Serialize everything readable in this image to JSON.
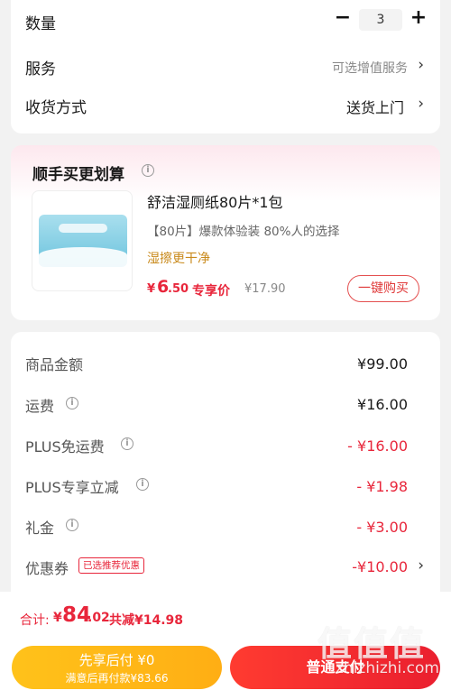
{
  "order": {
    "quantity_label": "数量",
    "quantity_value": "3",
    "minus_glyph": "−",
    "plus_glyph": "+",
    "service_label": "服务",
    "service_value": "可选增值服务",
    "delivery_label": "收货方式",
    "delivery_value": "送货上门",
    "chevron_glyph": "›"
  },
  "bundle": {
    "title": "顺手买更划算",
    "info_glyph": "i",
    "product": {
      "name": "舒洁湿厕纸80片*1包",
      "description": "【80片】爆款体验装 80%人的选择",
      "tag": "湿擦更干净",
      "price_symbol": "¥",
      "price_integer": "6",
      "price_decimal": ".50",
      "price_label": "专享价",
      "original_price": "¥17.90",
      "buy_button": "一键购买"
    }
  },
  "summary": {
    "rows": [
      {
        "label": "商品金额",
        "value": "¥99.00"
      },
      {
        "label": "运费",
        "value": "¥16.00"
      },
      {
        "label": "PLUS免运费",
        "value": "- ¥16.00"
      },
      {
        "label": "PLUS专享立减",
        "value": "- ¥1.98"
      },
      {
        "label": "礼金",
        "value": "- ¥3.00"
      },
      {
        "label": "优惠券",
        "value": "-¥10.00"
      }
    ],
    "coupon_badge": "已选推荐优惠"
  },
  "footer": {
    "total_label": "合计:",
    "total_symbol": "¥",
    "total_integer": "84",
    "total_decimal": ".02",
    "saved_text": "共减¥14.98",
    "pay_later_main": "先享后付 ¥0",
    "pay_later_sub": "满意后再付款¥83.66",
    "pay_normal": "普通支付"
  },
  "watermark": {
    "glyphs": "值值值",
    "url": "zhizhizhi.com"
  },
  "colors": {
    "accent_red": "#e8263b",
    "gold": "#ffb81a",
    "tag_gold": "#c98a1c"
  }
}
